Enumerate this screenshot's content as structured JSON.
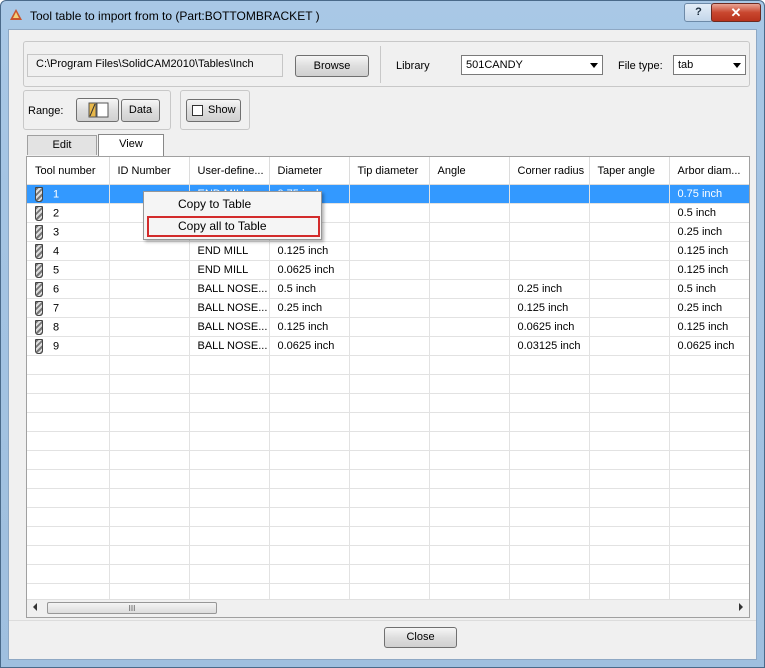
{
  "window": {
    "title": "Tool table to import from to (Part:BOTTOMBRACKET )",
    "help": "?",
    "close": "✕"
  },
  "toolbar": {
    "path": "C:\\Program Files\\SolidCAM2010\\Tables\\Inch",
    "browse_label": "Browse",
    "library_label": "Library",
    "library_value": "501CANDY",
    "filetype_label": "File type:",
    "filetype_value": "tab"
  },
  "range": {
    "label": "Range:",
    "data_label": "Data",
    "show_label": "Show"
  },
  "tabs": [
    {
      "label": "Edit"
    },
    {
      "label": "View"
    }
  ],
  "table": {
    "columns": [
      "Tool number",
      "ID Number",
      "User-define...",
      "Diameter",
      "Tip diameter",
      "Angle",
      "Corner radius",
      "Taper angle",
      "Arbor diam..."
    ],
    "rows": [
      [
        "1",
        "",
        "END MILL",
        "0.75 inch",
        "",
        "",
        "",
        "",
        "0.75 inch"
      ],
      [
        "2",
        "",
        "",
        "",
        "",
        "",
        "",
        "",
        "0.5 inch"
      ],
      [
        "3",
        "",
        "",
        "",
        "",
        "",
        "",
        "",
        "0.25 inch"
      ],
      [
        "4",
        "",
        "END MILL",
        "0.125 inch",
        "",
        "",
        "",
        "",
        "0.125 inch"
      ],
      [
        "5",
        "",
        "END MILL",
        "0.0625 inch",
        "",
        "",
        "",
        "",
        "0.125 inch"
      ],
      [
        "6",
        "",
        "BALL NOSE...",
        "0.5 inch",
        "",
        "",
        "0.25 inch",
        "",
        "0.5 inch"
      ],
      [
        "7",
        "",
        "BALL NOSE...",
        "0.25 inch",
        "",
        "",
        "0.125 inch",
        "",
        "0.25 inch"
      ],
      [
        "8",
        "",
        "BALL NOSE...",
        "0.125 inch",
        "",
        "",
        "0.0625 inch",
        "",
        "0.125 inch"
      ],
      [
        "9",
        "",
        "BALL NOSE...",
        "0.0625 inch",
        "",
        "",
        "0.03125 inch",
        "",
        "0.0625 inch"
      ]
    ],
    "selected_row": 1,
    "scroll_grip": "III"
  },
  "context_menu": {
    "items": [
      {
        "label": "Copy to Table"
      },
      {
        "label": "Copy all to Table",
        "highlighted": true
      }
    ]
  },
  "footer": {
    "close_label": "Close"
  }
}
